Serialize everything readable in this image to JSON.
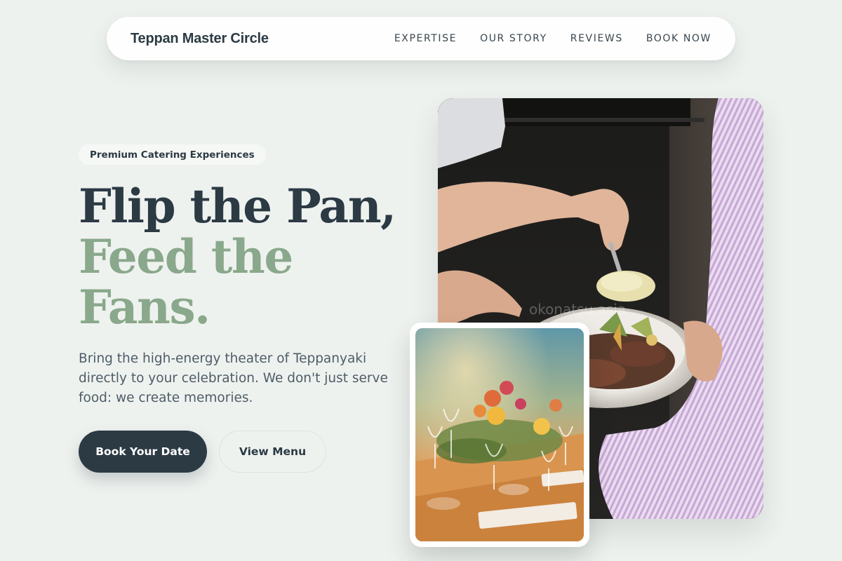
{
  "nav": {
    "brand": "Teppan Master Circle",
    "links": [
      "EXPERTISE",
      "OUR STORY",
      "REVIEWS",
      "BOOK NOW"
    ]
  },
  "hero": {
    "badge": "Premium Catering Experiences",
    "headline_line1": "Flip the Pan,",
    "headline_line2": "Feed the",
    "headline_line3": "Fans.",
    "lead": "Bring the high-energy theater of Teppanyaki directly to your celebration. We don't just serve food: we create memories.",
    "primary_cta": "Book Your Date",
    "secondary_cta": "View Menu"
  },
  "images": {
    "main_watermark": "okonatsu.asia"
  },
  "colors": {
    "background": "#eef2ef",
    "dark": "#2c3a44",
    "accent_green": "#8aa88b"
  }
}
